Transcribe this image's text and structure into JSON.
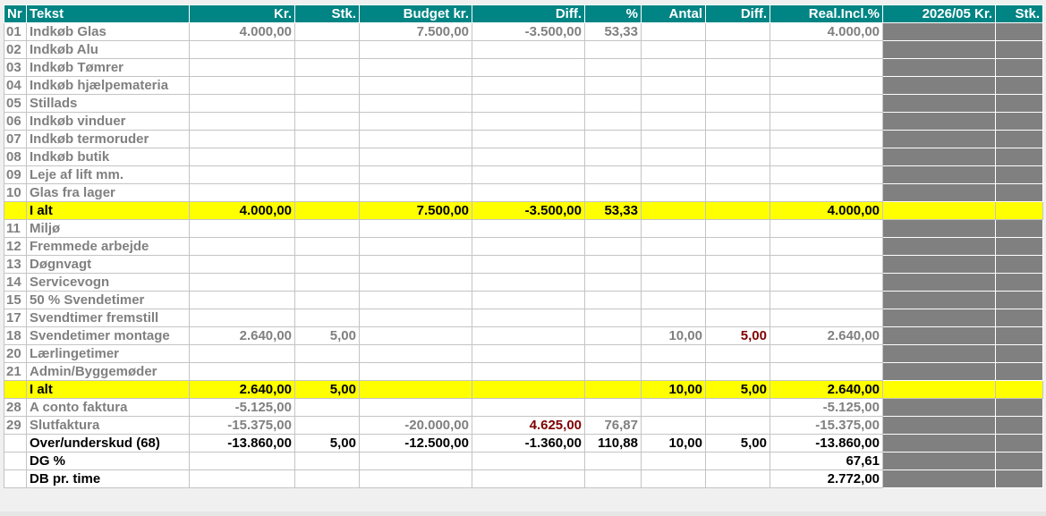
{
  "columns": [
    "Nr",
    "Tekst",
    "Kr.",
    "Stk.",
    "Budget kr.",
    "Diff.",
    "%",
    "Antal",
    "Diff.",
    "Real.Incl.%",
    "2026/05 Kr.",
    "Stk."
  ],
  "rows": [
    {
      "type": "item",
      "nr": "01",
      "text": "Indkøb Glas",
      "kr": "4.000,00",
      "stk": "",
      "budget": "7.500,00",
      "diff": "-3.500,00",
      "pct": "53,33",
      "antal": "",
      "diff2": "",
      "real": "4.000,00"
    },
    {
      "type": "item",
      "nr": "02",
      "text": "Indkøb Alu",
      "kr": "",
      "stk": "",
      "budget": "",
      "diff": "",
      "pct": "",
      "antal": "",
      "diff2": "",
      "real": ""
    },
    {
      "type": "item",
      "nr": "03",
      "text": "Indkøb Tømrer",
      "kr": "",
      "stk": "",
      "budget": "",
      "diff": "",
      "pct": "",
      "antal": "",
      "diff2": "",
      "real": ""
    },
    {
      "type": "item",
      "nr": "04",
      "text": "Indkøb hjælpemateria",
      "kr": "",
      "stk": "",
      "budget": "",
      "diff": "",
      "pct": "",
      "antal": "",
      "diff2": "",
      "real": ""
    },
    {
      "type": "item",
      "nr": "05",
      "text": "Stillads",
      "kr": "",
      "stk": "",
      "budget": "",
      "diff": "",
      "pct": "",
      "antal": "",
      "diff2": "",
      "real": ""
    },
    {
      "type": "item",
      "nr": "06",
      "text": "Indkøb vinduer",
      "kr": "",
      "stk": "",
      "budget": "",
      "diff": "",
      "pct": "",
      "antal": "",
      "diff2": "",
      "real": ""
    },
    {
      "type": "item",
      "nr": "07",
      "text": "Indkøb termoruder",
      "kr": "",
      "stk": "",
      "budget": "",
      "diff": "",
      "pct": "",
      "antal": "",
      "diff2": "",
      "real": ""
    },
    {
      "type": "item",
      "nr": "08",
      "text": "Indkøb butik",
      "kr": "",
      "stk": "",
      "budget": "",
      "diff": "",
      "pct": "",
      "antal": "",
      "diff2": "",
      "real": ""
    },
    {
      "type": "item",
      "nr": "09",
      "text": "Leje af lift mm.",
      "kr": "",
      "stk": "",
      "budget": "",
      "diff": "",
      "pct": "",
      "antal": "",
      "diff2": "",
      "real": ""
    },
    {
      "type": "item",
      "nr": "10",
      "text": "Glas fra lager",
      "kr": "",
      "stk": "",
      "budget": "",
      "diff": "",
      "pct": "",
      "antal": "",
      "diff2": "",
      "real": ""
    },
    {
      "type": "sum",
      "nr": "",
      "text": "I alt",
      "kr": "4.000,00",
      "stk": "",
      "budget": "7.500,00",
      "diff": "-3.500,00",
      "pct": "53,33",
      "antal": "",
      "diff2": "",
      "real": "4.000,00"
    },
    {
      "type": "item",
      "nr": "11",
      "text": "Miljø",
      "kr": "",
      "stk": "",
      "budget": "",
      "diff": "",
      "pct": "",
      "antal": "",
      "diff2": "",
      "real": ""
    },
    {
      "type": "item",
      "nr": "12",
      "text": "Fremmede arbejde",
      "kr": "",
      "stk": "",
      "budget": "",
      "diff": "",
      "pct": "",
      "antal": "",
      "diff2": "",
      "real": ""
    },
    {
      "type": "item",
      "nr": "13",
      "text": "Døgnvagt",
      "kr": "",
      "stk": "",
      "budget": "",
      "diff": "",
      "pct": "",
      "antal": "",
      "diff2": "",
      "real": ""
    },
    {
      "type": "item",
      "nr": "14",
      "text": "Servicevogn",
      "kr": "",
      "stk": "",
      "budget": "",
      "diff": "",
      "pct": "",
      "antal": "",
      "diff2": "",
      "real": ""
    },
    {
      "type": "item",
      "nr": "15",
      "text": "50 % Svendetimer",
      "kr": "",
      "stk": "",
      "budget": "",
      "diff": "",
      "pct": "",
      "antal": "",
      "diff2": "",
      "real": ""
    },
    {
      "type": "item",
      "nr": "17",
      "text": "Svendtimer fremstill",
      "kr": "",
      "stk": "",
      "budget": "",
      "diff": "",
      "pct": "",
      "antal": "",
      "diff2": "",
      "real": ""
    },
    {
      "type": "item",
      "nr": "18",
      "text": "Svendetimer montage",
      "kr": "2.640,00",
      "stk": "5,00",
      "budget": "",
      "diff": "",
      "pct": "",
      "antal": "10,00",
      "diff2": "5,00",
      "real": "2.640,00",
      "diff2_red": true
    },
    {
      "type": "item",
      "nr": "20",
      "text": "Lærlingetimer",
      "kr": "",
      "stk": "",
      "budget": "",
      "diff": "",
      "pct": "",
      "antal": "",
      "diff2": "",
      "real": ""
    },
    {
      "type": "item",
      "nr": "21",
      "text": "Admin/Byggemøder",
      "kr": "",
      "stk": "",
      "budget": "",
      "diff": "",
      "pct": "",
      "antal": "",
      "diff2": "",
      "real": ""
    },
    {
      "type": "sum",
      "nr": "",
      "text": "I alt",
      "kr": "2.640,00",
      "stk": "5,00",
      "budget": "",
      "diff": "",
      "pct": "",
      "antal": "10,00",
      "diff2": "5,00",
      "real": "2.640,00"
    },
    {
      "type": "item",
      "nr": "28",
      "text": "A conto faktura",
      "kr": "-5.125,00",
      "stk": "",
      "budget": "",
      "diff": "",
      "pct": "",
      "antal": "",
      "diff2": "",
      "real": "-5.125,00"
    },
    {
      "type": "item",
      "nr": "29",
      "text": "Slutfaktura",
      "kr": "-15.375,00",
      "stk": "",
      "budget": "-20.000,00",
      "diff": "4.625,00",
      "pct": "76,87",
      "antal": "",
      "diff2": "",
      "real": "-15.375,00",
      "diff_red": true
    },
    {
      "type": "total",
      "nr": "",
      "text": "Over/underskud (68)",
      "kr": "-13.860,00",
      "stk": "5,00",
      "budget": "-12.500,00",
      "diff": "-1.360,00",
      "pct": "110,88",
      "antal": "10,00",
      "diff2": "5,00",
      "real": "-13.860,00"
    },
    {
      "type": "total",
      "nr": "",
      "text": "DG %",
      "kr": "",
      "stk": "",
      "budget": "",
      "diff": "",
      "pct": "",
      "antal": "",
      "diff2": "",
      "real": "67,61"
    },
    {
      "type": "total",
      "nr": "",
      "text": "DB pr. time",
      "kr": "",
      "stk": "",
      "budget": "",
      "diff": "",
      "pct": "",
      "antal": "",
      "diff2": "",
      "real": "2.772,00"
    }
  ],
  "colors": {
    "header": "#008484",
    "sum_row": "#ffff00",
    "gray_column": "#808080",
    "negative_diff": "#800000"
  }
}
